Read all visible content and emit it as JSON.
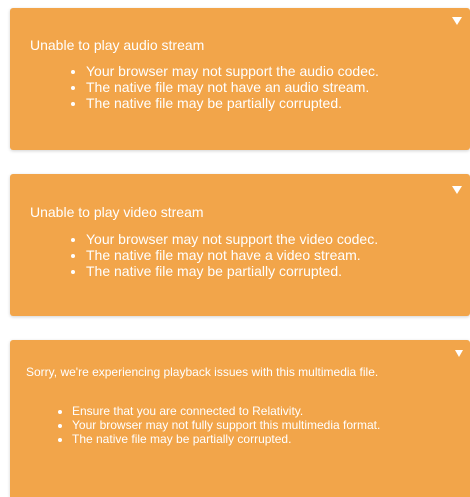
{
  "colors": {
    "alert_background": "#f2a54a",
    "alert_text": "#ffffff"
  },
  "alerts": [
    {
      "title": "Unable to play audio stream",
      "toggle_icon": "triangle-down-icon",
      "items": [
        "Your browser may not support the audio codec.",
        "The native file may not have an audio stream.",
        "The native file may be partially corrupted."
      ]
    },
    {
      "title": "Unable to play video stream",
      "toggle_icon": "triangle-down-icon",
      "items": [
        "Your browser may not support the video codec.",
        "The native file may not have a video stream.",
        "The native file may be partially corrupted."
      ]
    },
    {
      "title": "Sorry, we're experiencing playback issues with this multimedia file.",
      "toggle_icon": "triangle-down-icon",
      "items": [
        "Ensure that you are connected to Relativity.",
        "Your browser may not fully support this multimedia format.",
        "The native file may be partially corrupted."
      ]
    }
  ]
}
